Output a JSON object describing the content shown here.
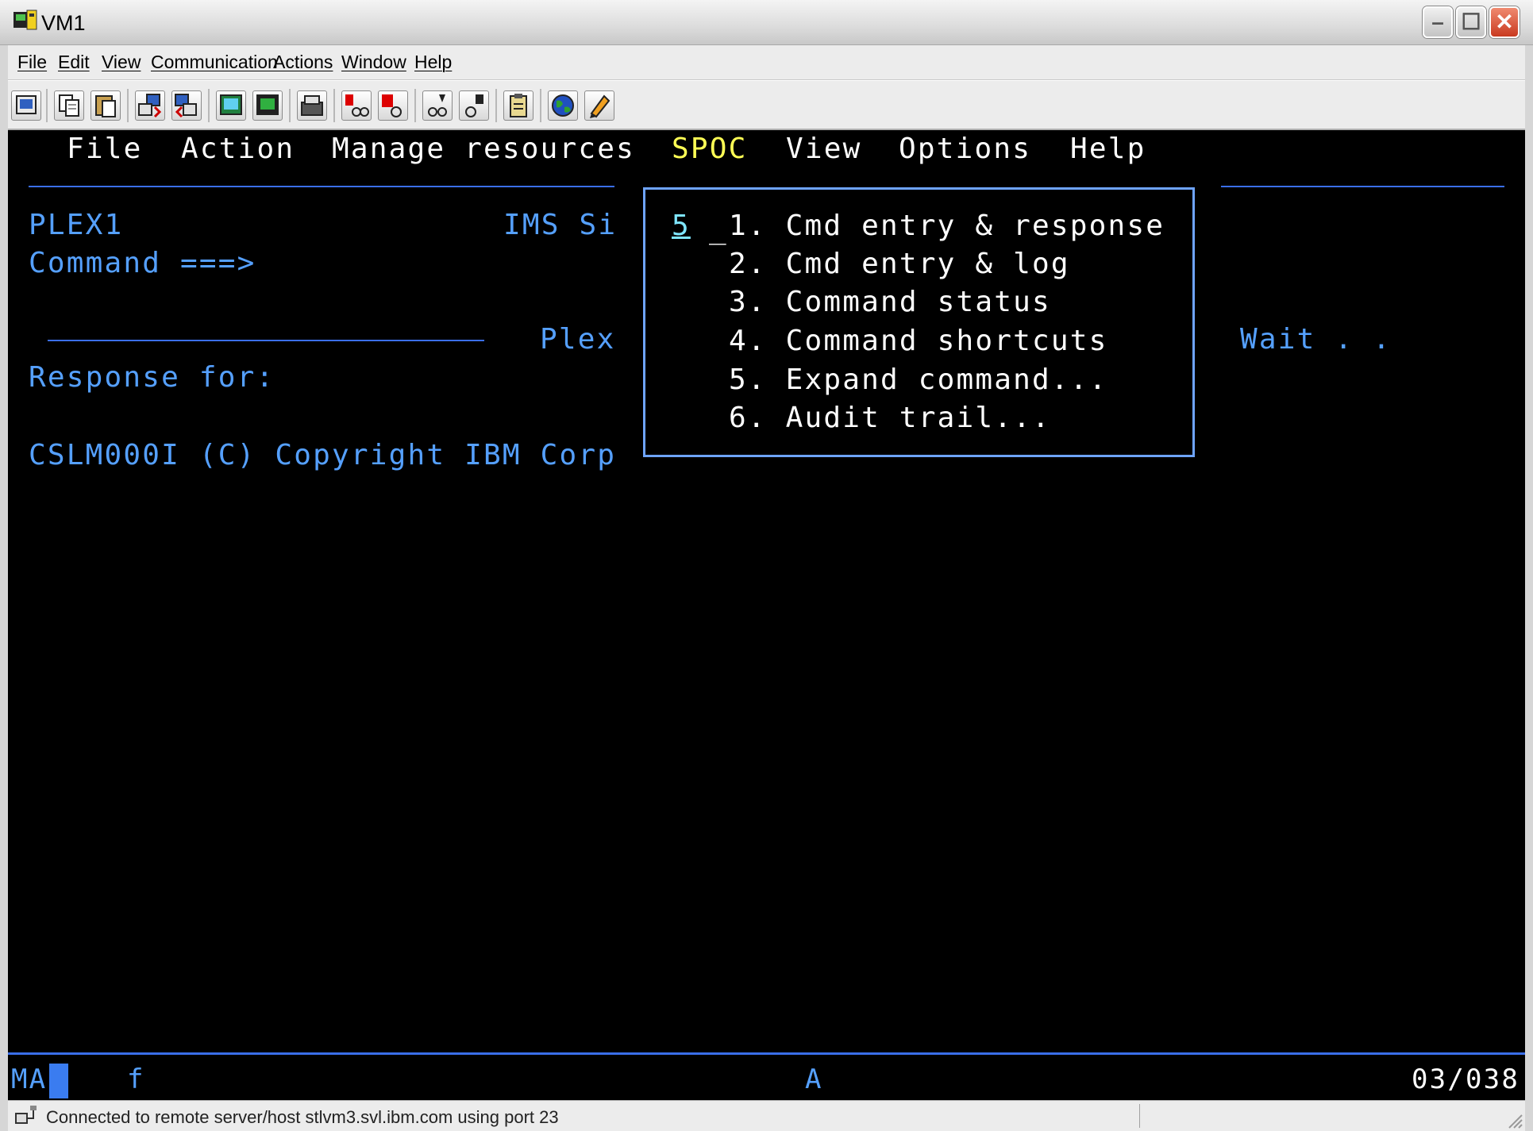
{
  "window": {
    "title": "VM1",
    "minimize_glyph": "–",
    "maximize_glyph": "☐",
    "close_glyph": "✕"
  },
  "menubar": {
    "items": [
      "File",
      "Edit",
      "View",
      "Communication",
      "Actions",
      "Window",
      "Help"
    ]
  },
  "toolbar": {
    "icons": [
      "print-screen-icon",
      "copy-icon",
      "paste-icon",
      "send-file-icon",
      "receive-file-icon",
      "display-icon",
      "keyboard-map-icon",
      "macro-icon",
      "record-macro-icon",
      "stop-macro-icon",
      "play-macro-icon",
      "pause-macro-icon",
      "clipboard-icon",
      "globe-icon",
      "edit-icon"
    ]
  },
  "terminal": {
    "action_bar": {
      "file": "File",
      "action": "Action",
      "manage": "Manage resources",
      "spoc": "SPOC",
      "view": "View",
      "options": "Options",
      "help": "Help"
    },
    "plex_id": "PLEX1",
    "ims_label": "IMS Si",
    "command_prompt": "Command ===>",
    "plex_label": "Plex",
    "wait_label": "Wait . .",
    "response_label": "Response for:",
    "copyright_line": "CSLM000I (C) Copyright IBM Corp",
    "popup": {
      "selection": "5",
      "cursor": "_",
      "items": [
        "1. Cmd entry & response",
        "2. Cmd entry & log",
        "3. Command status",
        "4. Command shortcuts",
        "5. Expand command...",
        "6. Audit trail..."
      ]
    },
    "colors": {
      "field_blue": "#55a0ff",
      "menu_white": "#ffffff",
      "selected_yellow": "#ffff55",
      "input_cyan": "#7fe6ff"
    }
  },
  "oia": {
    "mode": "MA",
    "indicator": "f",
    "session": "A",
    "cursor_position": "03/038"
  },
  "statusbar": {
    "text": "Connected to remote server/host stlvm3.svl.ibm.com using port 23"
  }
}
